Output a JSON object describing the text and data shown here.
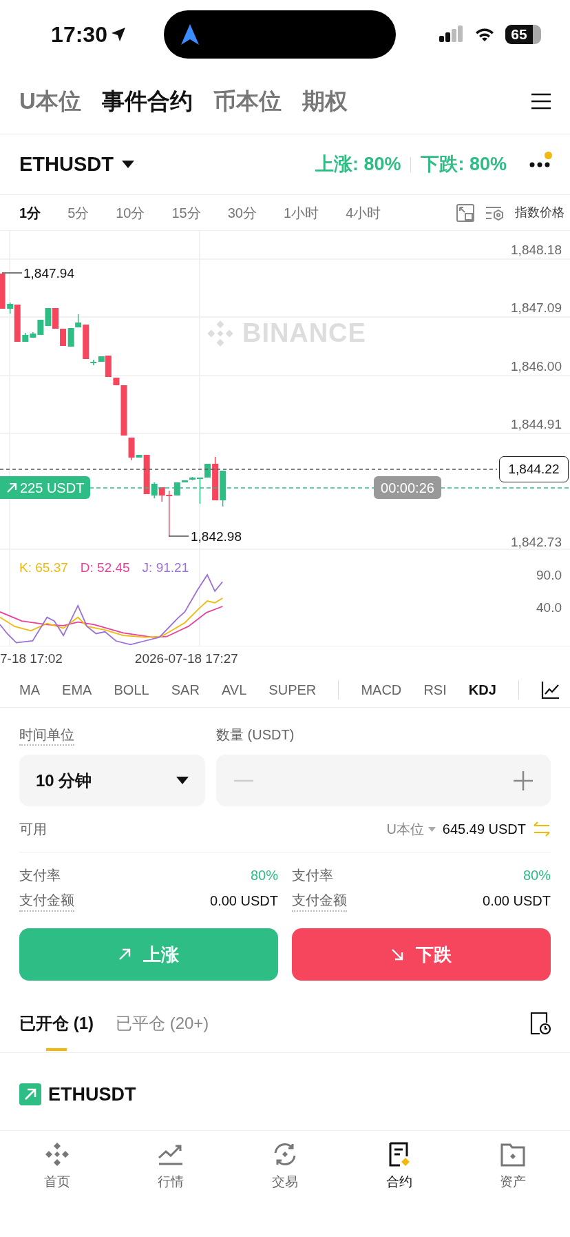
{
  "status_bar": {
    "time": "17:30",
    "battery": "65"
  },
  "top_tabs": [
    {
      "label": "U本位",
      "selected": false
    },
    {
      "label": "事件合约",
      "selected": true
    },
    {
      "label": "币本位",
      "selected": false
    },
    {
      "label": "期权",
      "selected": false
    }
  ],
  "symbol": {
    "name": "ETHUSDT",
    "rates": [
      "上涨: 80%",
      "下跌: 80%"
    ],
    "notification": true
  },
  "intervals": [
    {
      "label": "1分",
      "selected": true
    },
    {
      "label": "5分",
      "selected": false
    },
    {
      "label": "10分",
      "selected": false
    },
    {
      "label": "15分",
      "selected": false
    },
    {
      "label": "30分",
      "selected": false
    },
    {
      "label": "1小时",
      "selected": false
    },
    {
      "label": "4小时",
      "selected": false
    }
  ],
  "price_source": "指数价格",
  "price_chart": {
    "watermark": "BINANCE",
    "axis_labels": [
      "1,848.18",
      "1,847.09",
      "1,846.00",
      "1,844.91",
      "1,842.73"
    ],
    "high_label": "1,847.94",
    "low_label": "1,842.98",
    "current_price": "1,844.22",
    "position": "225 USDT",
    "countdown": "00:00:26"
  },
  "kdj": {
    "values": [
      {
        "text": "K: 65.37",
        "color": "#f0b90b"
      },
      {
        "text": "D: 52.45",
        "color": "#e8419c"
      },
      {
        "text": "J: 91.21",
        "color": "#9b6fd8"
      }
    ],
    "axis_labels": [
      "90.0",
      "40.0"
    ]
  },
  "time_axis": [
    "7-18 17:02",
    "2026-07-18 17:27"
  ],
  "indicator_groups": [
    {
      "items": [
        {
          "label": "MA",
          "selected": false
        },
        {
          "label": "EMA",
          "selected": false
        },
        {
          "label": "BOLL",
          "selected": false
        },
        {
          "label": "SAR",
          "selected": false
        },
        {
          "label": "AVL",
          "selected": false
        },
        {
          "label": "SUPER",
          "selected": false
        }
      ]
    },
    {
      "items": [
        {
          "label": "MACD",
          "selected": false
        },
        {
          "label": "RSI",
          "selected": false
        },
        {
          "label": "KDJ",
          "selected": true
        }
      ]
    }
  ],
  "order_form": {
    "duration_label": "时间单位",
    "duration": "10 分钟",
    "amount_label": "数量 (USDT)",
    "available_label": "可用",
    "account": "U本位",
    "balance": "645.49 USDT",
    "sides": [
      {
        "kind": "up",
        "payout_label": "支付率",
        "payout": "80%",
        "amount_label": "支付金额",
        "amount": "0.00 USDT",
        "button": "上涨"
      },
      {
        "kind": "down",
        "payout_label": "支付率",
        "payout": "80%",
        "amount_label": "支付金额",
        "amount": "0.00 USDT",
        "button": "下跌"
      }
    ]
  },
  "position_tabs": [
    {
      "label": "已开仓 (1)",
      "selected": true
    },
    {
      "label": "已平仓 (20+)",
      "selected": false
    }
  ],
  "positions": [
    {
      "symbol": "ETHUSDT",
      "kind": "up"
    }
  ],
  "nav": [
    {
      "label": "首页",
      "kind": "home",
      "selected": false
    },
    {
      "label": "行情",
      "kind": "markets",
      "selected": false
    },
    {
      "label": "交易",
      "kind": "trade",
      "selected": false
    },
    {
      "label": "合约",
      "kind": "futures",
      "selected": true
    },
    {
      "label": "资产",
      "kind": "assets",
      "selected": false
    }
  ]
}
